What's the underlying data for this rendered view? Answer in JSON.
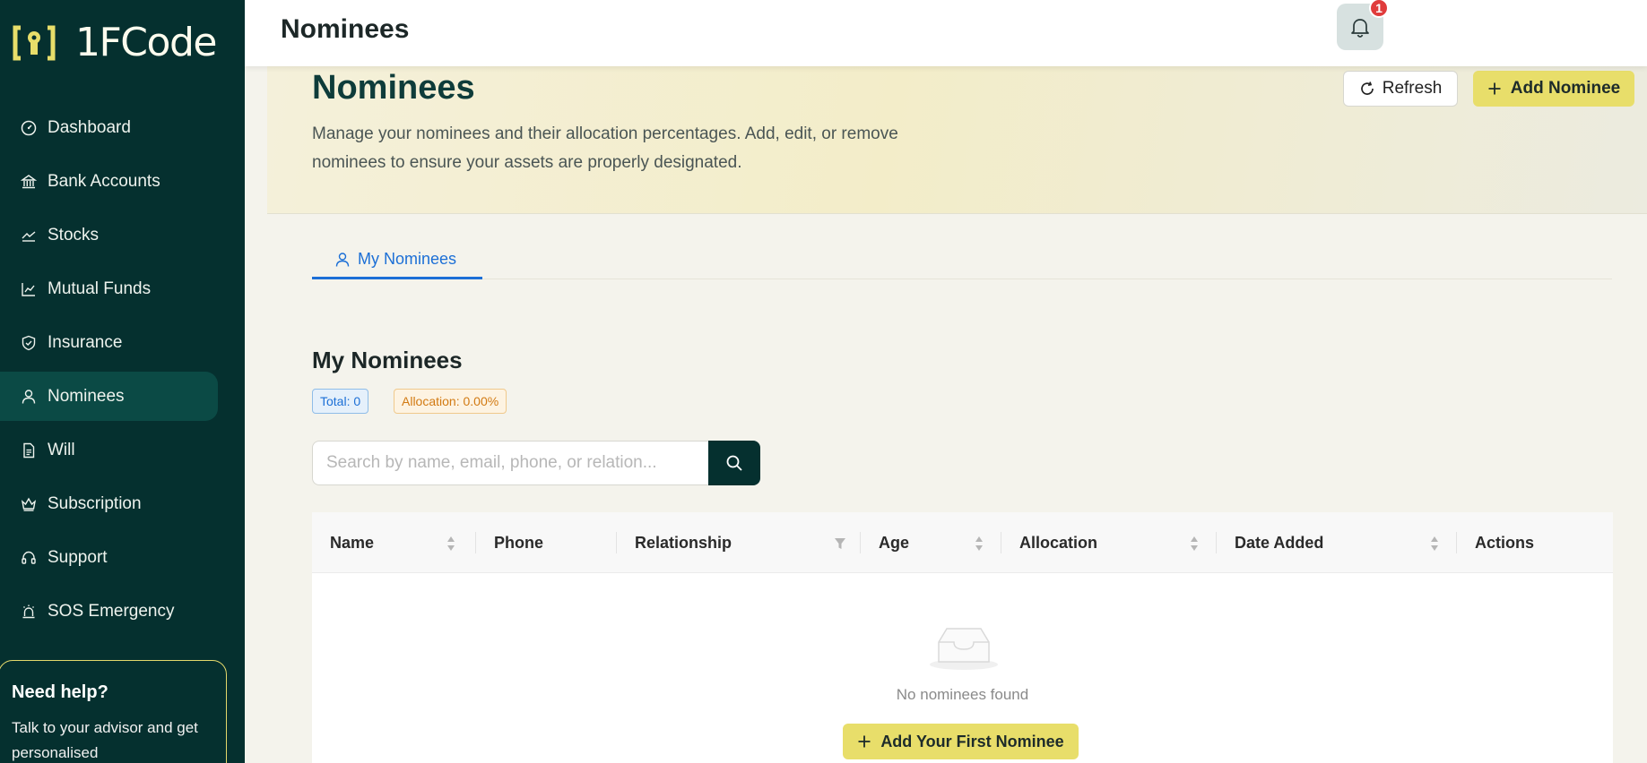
{
  "brand": {
    "name": "1FCode"
  },
  "sidebar": {
    "items": [
      {
        "label": "Dashboard",
        "icon": "dashboard-icon"
      },
      {
        "label": "Bank Accounts",
        "icon": "bank-icon"
      },
      {
        "label": "Stocks",
        "icon": "stock-chart-icon"
      },
      {
        "label": "Mutual Funds",
        "icon": "line-chart-icon"
      },
      {
        "label": "Insurance",
        "icon": "shield-check-icon"
      },
      {
        "label": "Nominees",
        "icon": "user-icon",
        "active": true
      },
      {
        "label": "Will",
        "icon": "document-icon"
      },
      {
        "label": "Subscription",
        "icon": "crown-icon"
      },
      {
        "label": "Support",
        "icon": "headset-icon"
      },
      {
        "label": "SOS Emergency",
        "icon": "alarm-icon"
      }
    ],
    "help": {
      "title": "Need help?",
      "text": "Talk to your advisor and get personalised"
    }
  },
  "topbar": {
    "title": "Nominees",
    "notification_count": "1"
  },
  "hero": {
    "title": "Nominees",
    "description": "Manage your nominees and their allocation percentages. Add, edit, or remove nominees to ensure your assets are properly designated.",
    "refresh_label": "Refresh",
    "add_label": "Add Nominee"
  },
  "tabs": [
    {
      "label": "My Nominees"
    }
  ],
  "section": {
    "title": "My Nominees",
    "total_badge": "Total: 0",
    "allocation_badge": "Allocation: 0.00%"
  },
  "search": {
    "placeholder": "Search by name, email, phone, or relation...",
    "value": ""
  },
  "table": {
    "columns": [
      "Name",
      "Phone",
      "Relationship",
      "Age",
      "Allocation",
      "Date Added",
      "Actions"
    ],
    "empty_text": "No nominees found",
    "empty_button": "Add Your First Nominee"
  },
  "colors": {
    "sidebar_bg": "#05302f",
    "accent_yellow": "#e8de6a",
    "link_blue": "#1c6fd6",
    "badge_red": "#e03c3c"
  }
}
